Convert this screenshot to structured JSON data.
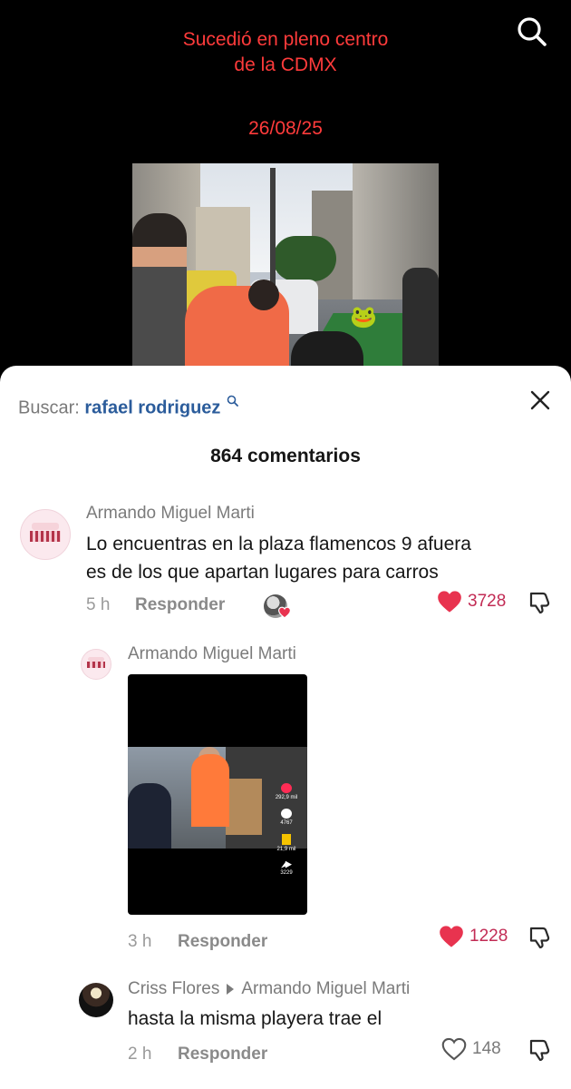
{
  "video": {
    "caption_line1": "Sucedió en pleno centro",
    "caption_line2": "de la CDMX",
    "date": "26/08/25",
    "sticker": "🐸",
    "search_icon": "search-icon"
  },
  "comments_sheet": {
    "search_label": "Buscar:",
    "search_query": "rafael rodriguez",
    "close_icon": "close-icon",
    "count": "864 comentarios",
    "comments": [
      {
        "author": "Armando Miguel Marti",
        "text_line1": "Lo encuentras en la plaza flamencos 9 afuera",
        "text_line2": "es de los que apartan lugares para carros",
        "time": "5 h",
        "reply": "Responder",
        "likes": "3728",
        "liked": true
      },
      {
        "author": "Armando Miguel Marti",
        "attachment": "video-thumbnail",
        "thumb_likes": "292,9 mil",
        "thumb_comments": "4767",
        "thumb_saves": "21,9 mil",
        "thumb_shares": "3229",
        "time": "3 h",
        "reply": "Responder",
        "likes": "1228",
        "liked": true
      },
      {
        "author": "Criss Flores",
        "reply_to": "Armando Miguel Marti",
        "text": "hasta la misma playera trae el",
        "time": "2 h",
        "reply": "Responder",
        "likes": "148",
        "liked": false
      }
    ]
  },
  "colors": {
    "caption_red": "#ff3b3b",
    "search_blue": "#2b5c9b",
    "like_red": "#e8334f"
  }
}
